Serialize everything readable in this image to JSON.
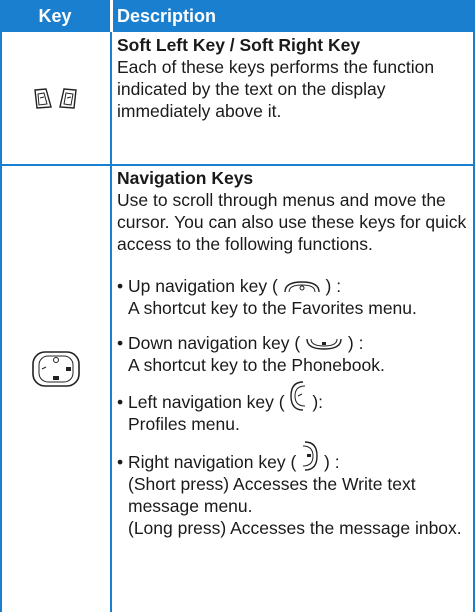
{
  "header": {
    "key": "Key",
    "description": "Description"
  },
  "rows": [
    {
      "title": "Soft Left Key / Soft Right Key",
      "text": "Each of these keys performs the function indicated by the text on the display immediately above it."
    },
    {
      "title": "Navigation Keys",
      "text": "Use to scroll through menus and move the cursor. You can also use these keys for quick access to the following functions.",
      "bullets": [
        {
          "label_pre": "• Up navigation key (",
          "label_post": ") :",
          "sub": [
            "A shortcut key to the Favorites menu."
          ]
        },
        {
          "label_pre": "• Down navigation key (",
          "label_post": ") :",
          "sub": [
            "A shortcut key to the Phonebook."
          ]
        },
        {
          "label_pre": "• Left navigation key (",
          "label_post": "):",
          "sub": [
            "Profiles menu."
          ]
        },
        {
          "label_pre": "• Right navigation key (",
          "label_post": ") :",
          "sub": [
            "(Short press) Accesses the Write text message menu.",
            "(Long press) Accesses the message inbox."
          ]
        }
      ]
    }
  ]
}
